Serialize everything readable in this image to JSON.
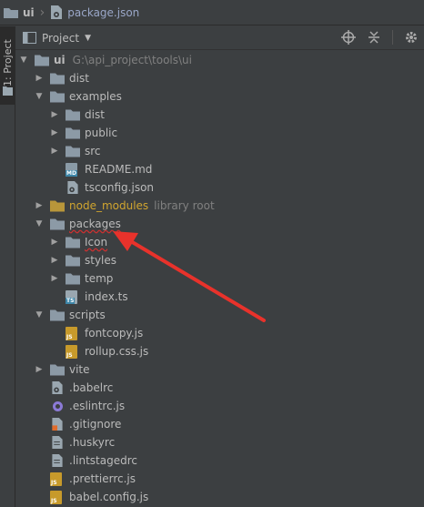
{
  "breadcrumb": {
    "root": "ui",
    "file": "package.json"
  },
  "side_panel": {
    "tab_label": "1: Project"
  },
  "toolwindow": {
    "title": "Project",
    "icons": [
      "locate-icon",
      "collapse-all-icon",
      "settings-icon"
    ]
  },
  "tree": {
    "root": {
      "name": "ui",
      "path": "G:\\api_project\\tools\\ui"
    },
    "items": [
      {
        "id": "dist",
        "label": "dist"
      },
      {
        "id": "examples",
        "label": "examples"
      },
      {
        "id": "examples-dist",
        "label": "dist"
      },
      {
        "id": "public",
        "label": "public"
      },
      {
        "id": "src",
        "label": "src"
      },
      {
        "id": "readme",
        "label": "README.md"
      },
      {
        "id": "tsconfig",
        "label": "tsconfig.json"
      },
      {
        "id": "node-modules",
        "label": "node_modules",
        "suffix": "library root"
      },
      {
        "id": "packages",
        "label": "packages"
      },
      {
        "id": "icon",
        "label": "Icon"
      },
      {
        "id": "styles",
        "label": "styles"
      },
      {
        "id": "temp",
        "label": "temp"
      },
      {
        "id": "index-ts",
        "label": "index.ts"
      },
      {
        "id": "scripts",
        "label": "scripts"
      },
      {
        "id": "fontcopy",
        "label": "fontcopy.js"
      },
      {
        "id": "rollup-css",
        "label": "rollup.css.js"
      },
      {
        "id": "vite",
        "label": "vite"
      },
      {
        "id": "babelrc",
        "label": ".babelrc"
      },
      {
        "id": "eslintrc",
        "label": ".eslintrc.js"
      },
      {
        "id": "gitignore",
        "label": ".gitignore"
      },
      {
        "id": "huskyrc",
        "label": ".huskyrc"
      },
      {
        "id": "lintstagedrc",
        "label": ".lintstagedrc"
      },
      {
        "id": "prettierrc",
        "label": ".prettierrc.js"
      },
      {
        "id": "babel-config",
        "label": "babel.config.js"
      }
    ]
  },
  "annotation": {
    "arrow_color": "#e8322b",
    "points_to": "Icon"
  }
}
